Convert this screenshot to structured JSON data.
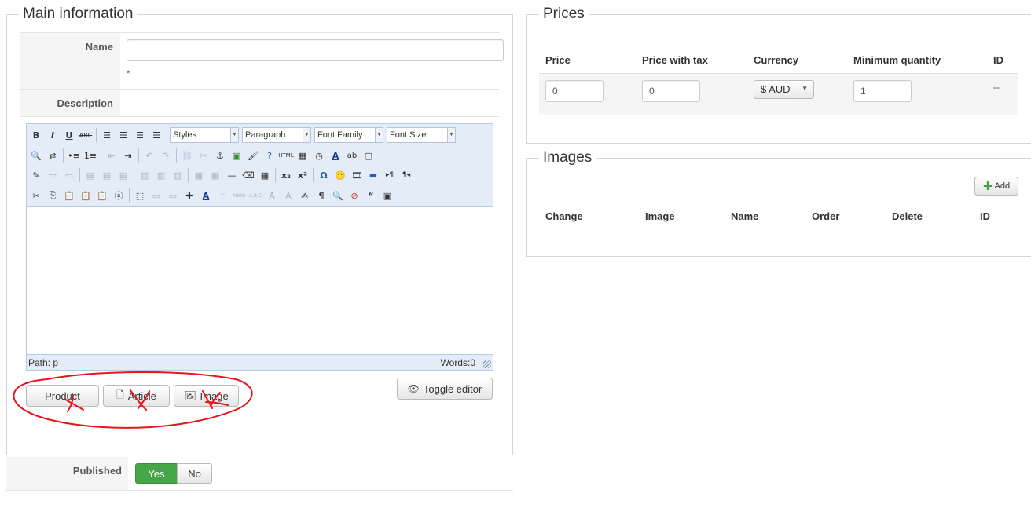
{
  "main": {
    "legend": "Main information",
    "name_label": "Name",
    "name_value": "",
    "required_mark": "*",
    "description_label": "Description"
  },
  "editor": {
    "toolbar": {
      "styles_select": "Styles",
      "format_select": "Paragraph",
      "font_family_select": "Font Family",
      "font_size_select": "Font Size"
    },
    "status_path": "Path: p",
    "word_count": "Words:0"
  },
  "buttons": {
    "product": "Product",
    "article": "Article",
    "image": "Image",
    "toggle_editor": "Toggle editor"
  },
  "published": {
    "label": "Published",
    "yes": "Yes",
    "no": "No",
    "selected": "Yes",
    "yes_color": "#46a546"
  },
  "prices": {
    "legend": "Prices",
    "headers": [
      "Price",
      "Price with tax",
      "Currency",
      "Minimum quantity",
      "ID"
    ],
    "row": {
      "price": "0",
      "price_with_tax": "0",
      "currency": "$ AUD",
      "minimum_quantity": "1",
      "id": "--"
    }
  },
  "images": {
    "legend": "Images",
    "add_button": "Add",
    "headers": [
      "Change",
      "Image",
      "Name",
      "Order",
      "Delete",
      "ID"
    ]
  },
  "annotation": {
    "color": "#e8141c"
  }
}
